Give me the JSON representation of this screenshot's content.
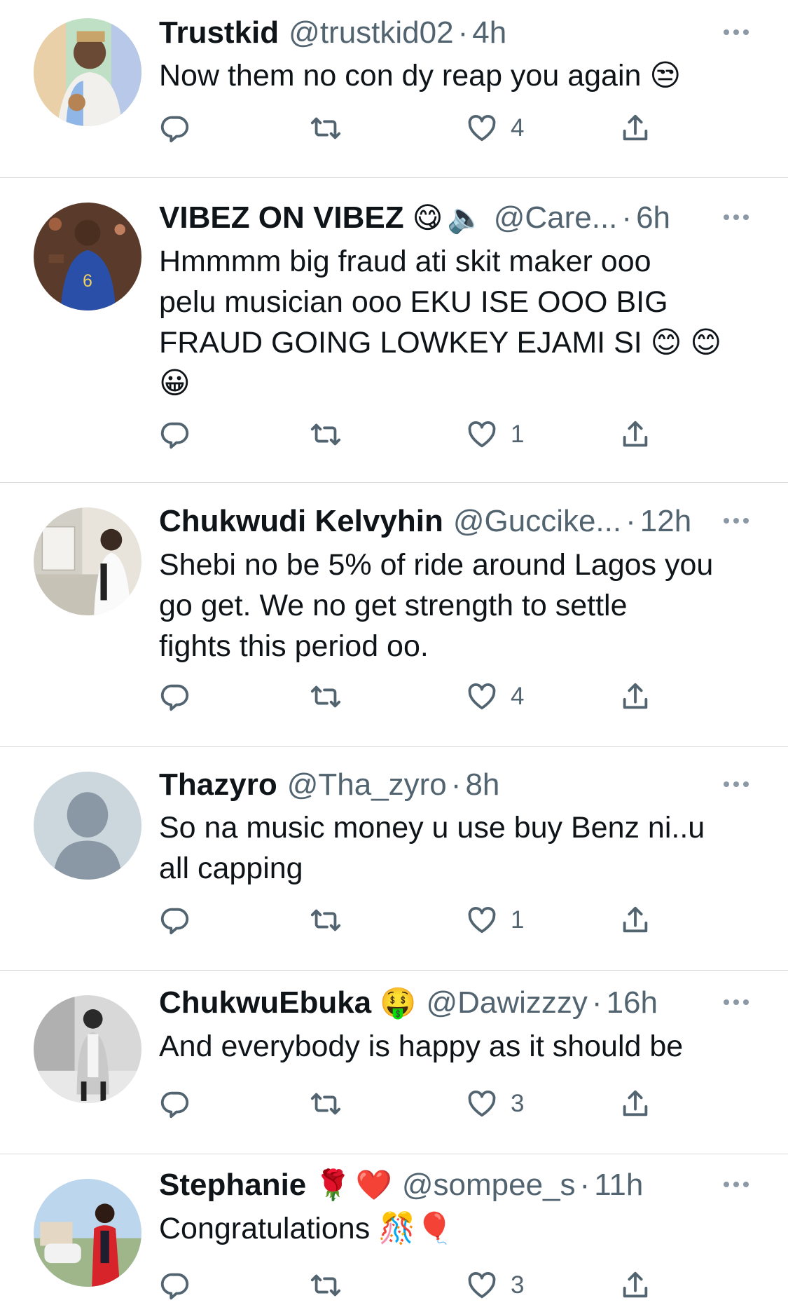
{
  "colors": {
    "text": "#0f1419",
    "secondary": "#536471",
    "divider": "#d9d9d9",
    "icon": "#536471"
  },
  "replies": [
    {
      "name": "Trustkid",
      "badges": [],
      "handle": "@trustkid02",
      "time": "4h",
      "text": "Now them no con dy reap you again 😒",
      "likes": "4",
      "avatar": "avatar-person-white-shirt"
    },
    {
      "name": "VIBEZ ON VIBEZ",
      "badges": [
        "😋",
        "🔈"
      ],
      "handle": "@Care...",
      "time": "6h",
      "text": "Hmmmm big fraud ati skit maker ooo\npelu musician ooo EKU ISE OOO BIG\nFRAUD GOING LOWKEY EJAMI SI 😊 😊\n😀",
      "likes": "1",
      "avatar": "avatar-basketball-player"
    },
    {
      "name": "Chukwudi Kelvyhin",
      "badges": [],
      "handle": "@Guccike...",
      "time": "12h",
      "text": "Shebi no be 5% of ride around Lagos you\ngo get. We no get strength to settle\nfights this period oo.",
      "likes": "4",
      "avatar": "avatar-person-mirror"
    },
    {
      "name": "Thazyro",
      "badges": [],
      "handle": "@Tha_zyro",
      "time": "8h",
      "text": "So na music money u use buy Benz ni..u\nall capping",
      "likes": "1",
      "avatar": "avatar-default"
    },
    {
      "name": "ChukwuEbuka",
      "badges": [
        "🤑"
      ],
      "handle": "@Dawizzzy",
      "time": "16h",
      "text": "And everybody is happy as it should be",
      "likes": "3",
      "avatar": "avatar-person-blazer"
    },
    {
      "name": "Stephanie",
      "badges": [
        "🌹",
        "❤️"
      ],
      "handle": "@sompee_s",
      "time": "11h",
      "text": "Congratulations 🎊🎈",
      "likes": "3",
      "avatar": "avatar-person-red-outfit"
    }
  ],
  "icons": {
    "reply": "reply-icon",
    "retweet": "retweet-icon",
    "like": "heart-icon",
    "share": "share-icon",
    "more": "more-icon"
  }
}
